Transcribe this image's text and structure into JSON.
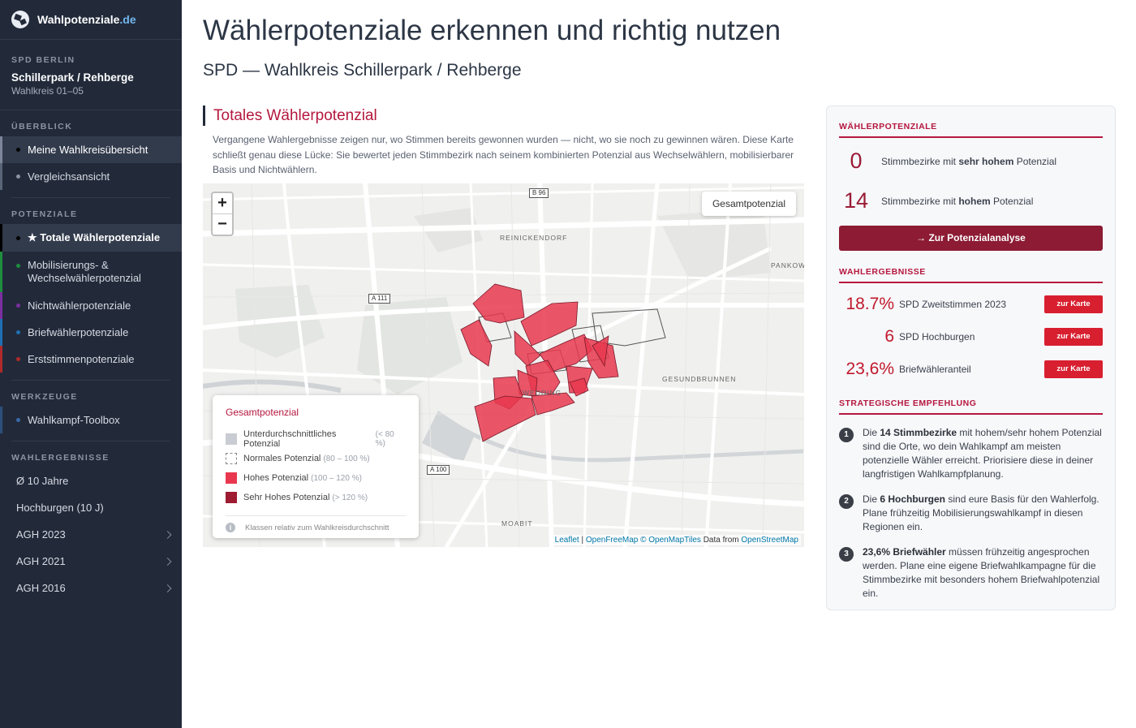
{
  "brand": {
    "name": "Wahlpotenziale",
    "tld": ".de"
  },
  "sidebar": {
    "party_label": "SPD BERLIN",
    "district_name": "Schillerpark / Rehberge",
    "district_sub": "Wahlkreis 01–05",
    "sections": {
      "overview": "ÜBERBLICK",
      "potentials": "POTENZIALE",
      "tools": "WERKZEUGE",
      "results": "WAHLERGEBNISSE"
    },
    "overview_items": [
      "Meine Wahlkreisübersicht",
      "Vergleichsansicht"
    ],
    "potential_items": [
      "★ Totale Wählerpotenziale",
      "Mobilisierungs- & Wechselwählerpotenzial",
      "Nichtwählerpotenziale",
      "Briefwählerpotenziale",
      "Erststimmenpotenziale"
    ],
    "tool_items": [
      "Wahlkampf-Toolbox"
    ],
    "result_items": [
      "Ø 10 Jahre",
      "Hochburgen (10 J)",
      "AGH 2023",
      "AGH 2021",
      "AGH 2016"
    ],
    "accent_colors": {
      "potential_total": "#000000",
      "mobilisierung": "#1e8e3e",
      "nichtwaehler": "#7b2fa0",
      "briefwaehler": "#1f6fb2",
      "erststimmen": "#b02a2a",
      "toolbox": "#2d4f7c"
    }
  },
  "header": {
    "title": "Wählerpotenziale erkennen und richtig nutzen",
    "subtitle": "SPD — Wahlkreis Schillerpark / Rehberge"
  },
  "section": {
    "title": "Totales Wählerpotenzial",
    "intro": "Vergangene Wahlergebnisse zeigen nur, wo Stimmen bereits gewonnen wurden — nicht, wo sie noch zu gewinnen wären. Diese Karte schließt genau diese Lücke: Sie bewertet jeden Stimmbezirk nach seinem kombinierten Potenzial aus Wechselwählern, mobilisierbarer Basis und Nichtwählern."
  },
  "map": {
    "zoom_in": "+",
    "zoom_out": "−",
    "layer_button": "Gesamtpotenzial",
    "labels": {
      "reinickendorf": "REINICKENDORF",
      "pankow": "PANKOW",
      "gesundbrunnen": "GESUNDBRUNNEN",
      "wedding": "WEDDING",
      "moabit": "MOABIT"
    },
    "roads": {
      "b96": "B 96",
      "a111": "A 111",
      "a100": "A 100"
    },
    "legend": {
      "title": "Gesamtpotenzial",
      "items": [
        {
          "label": "Unterdurchschnittliches Potenzial",
          "range": "(< 80 %)",
          "color": "#c9ccd2"
        },
        {
          "label": "Normales Potenzial",
          "range": "(80 – 100 %)",
          "color": "#ffffff"
        },
        {
          "label": "Hohes Potenzial",
          "range": "(100 – 120 %)",
          "color": "#e8384f"
        },
        {
          "label": "Sehr Hohes Potenzial",
          "range": "(> 120 %)",
          "color": "#9e1b32"
        }
      ],
      "note": "Klassen relativ zum Wahlkreisdurchschnitt"
    },
    "attribution": {
      "leaflet": "Leaflet",
      "sep": " | ",
      "tiles": "OpenFreeMap © OpenMapTiles",
      "data_from": " Data from ",
      "osm": "OpenStreetMap"
    }
  },
  "panel": {
    "potentials_head": "WÄHLERPOTENZIALE",
    "stat1": {
      "value": "0",
      "pre": "Stimmbezirke mit ",
      "bold": "sehr hohem",
      "post": " Potenzial"
    },
    "stat2": {
      "value": "14",
      "pre": "Stimmbezirke mit ",
      "bold": "hohem",
      "post": " Potenzial"
    },
    "cta": "→ Zur Potenzialanalyse",
    "results_head": "WAHLERGEBNISSE",
    "results": [
      {
        "value": "18.7%",
        "label": "SPD Zweitstimmen 2023",
        "button": "zur Karte"
      },
      {
        "value": "6",
        "label": "SPD Hochburgen",
        "button": "zur Karte"
      },
      {
        "value": "23,6%",
        "label": "Briefwähleranteil",
        "button": "zur Karte"
      }
    ],
    "strategy_head": "STRATEGISCHE EMPFEHLUNG",
    "recs": [
      {
        "num": "1",
        "pre": "Die ",
        "bold": "14 Stimmbezirke",
        "post": " mit hohem/sehr hohem Potenzial sind die Orte, wo dein Wahlkampf am meisten potenzielle Wähler erreicht. Priorisiere diese in deiner langfristigen Wahlkampfplanung."
      },
      {
        "num": "2",
        "pre": "Die ",
        "bold": "6 Hochburgen",
        "post": " sind eure Basis für den Wahlerfolg. Plane frühzeitig Mobilisierungswahlkampf in diesen Regionen ein."
      },
      {
        "num": "3",
        "pre": "",
        "bold": "23,6% Briefwähler",
        "post": " müssen frühzeitig angesprochen werden. Plane eine eigene Briefwahlkampagne für die Stimmbezirke mit besonders hohem Briefwahlpotenzial ein."
      }
    ]
  }
}
